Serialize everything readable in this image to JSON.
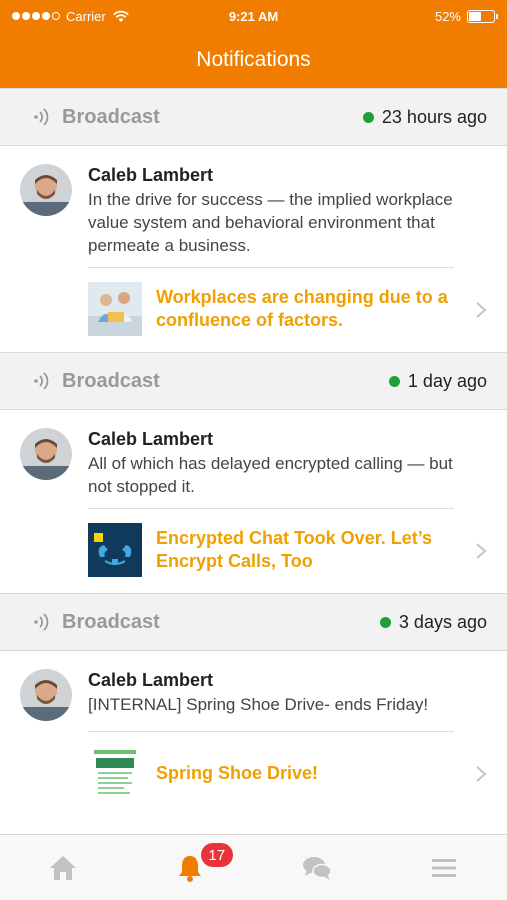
{
  "status_bar": {
    "carrier": "Carrier",
    "time": "9:21 AM",
    "battery": "52%",
    "battery_level": 0.52
  },
  "nav": {
    "title": "Notifications"
  },
  "notifications": [
    {
      "category": "Broadcast",
      "time": "23 hours ago",
      "author": "Caleb Lambert",
      "message": "In the drive for success — the implied workplace value system and behavioral environment that permeate a business.",
      "link_title": "Workplaces are changing due to a confluence of factors."
    },
    {
      "category": "Broadcast",
      "time": "1 day ago",
      "author": "Caleb Lambert",
      "message": "All of which has delayed encrypted calling — but not stopped it.",
      "link_title": "Encrypted Chat Took Over. Let’s Encrypt Calls, Too"
    },
    {
      "category": "Broadcast",
      "time": "3 days ago",
      "author": "Caleb Lambert",
      "message": "[INTERNAL] Spring Shoe Drive- ends Friday!",
      "link_title": "Spring Shoe Drive!"
    }
  ],
  "tabbar": {
    "badge_count": "17",
    "active_tab": "notifications",
    "tabs": [
      "home",
      "notifications",
      "chat",
      "menu"
    ]
  },
  "colors": {
    "accent": "#f07d00",
    "link": "#f0a000",
    "online": "#1f9e3a",
    "badge": "#e8323c"
  }
}
